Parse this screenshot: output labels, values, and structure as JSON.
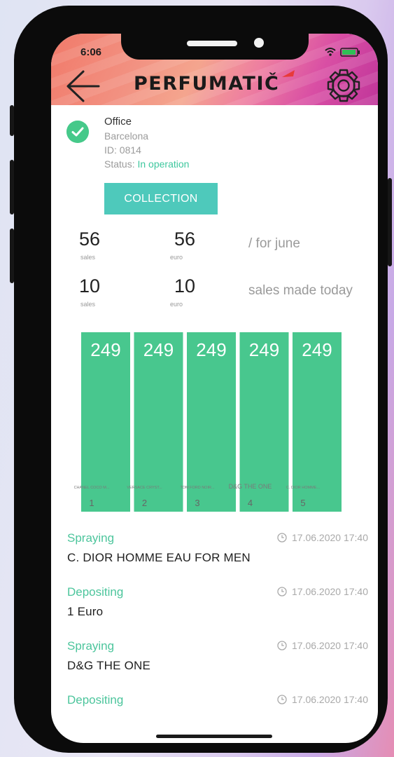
{
  "status_bar": {
    "time": "6:06",
    "icons": [
      "wifi-icon",
      "battery-icon"
    ]
  },
  "header": {
    "logo": "PERFUMATIČ",
    "back_icon": "arrow-left-icon",
    "settings_icon": "gear-icon"
  },
  "machine": {
    "name": "Office",
    "city": "Barcelona",
    "id_text": "ID: 0814",
    "status_label": "Status:",
    "status_value": "In operation",
    "status_icon": "check-circle-icon"
  },
  "collection_button": "COLLECTION",
  "stats": {
    "month": {
      "sales": "56",
      "sales_unit": "sales",
      "euro": "56",
      "euro_unit": "euro",
      "label": "/ for june"
    },
    "today": {
      "sales": "10",
      "sales_unit": "sales",
      "euro": "10",
      "euro_unit": "euro",
      "label": "sales made today"
    }
  },
  "chart_data": {
    "type": "bar",
    "categories": [
      "1",
      "2",
      "3",
      "4",
      "5"
    ],
    "category_names": [
      "CHANEL COCO M...",
      "VERSACE CRYST...",
      "TOM FORD NOIR...",
      "D&G THE ONE",
      "C. DIOR HOMME..."
    ],
    "values": [
      249,
      249,
      249,
      249,
      249
    ],
    "bar_color": "#48c78e"
  },
  "feed": [
    {
      "action": "Spraying",
      "time": "17.06.2020 17:40",
      "detail": "C. DIOR HOMME EAU FOR MEN"
    },
    {
      "action": "Depositing",
      "time": "17.06.2020 17:40",
      "detail": "1 Euro"
    },
    {
      "action": "Spraying",
      "time": "17.06.2020 17:40",
      "detail": "D&G THE ONE"
    },
    {
      "action": "Depositing",
      "time": "17.06.2020 17:40",
      "detail": ""
    }
  ],
  "colors": {
    "accent": "#4ec9bb",
    "green": "#48c78e",
    "status_green": "#3ec79e"
  }
}
